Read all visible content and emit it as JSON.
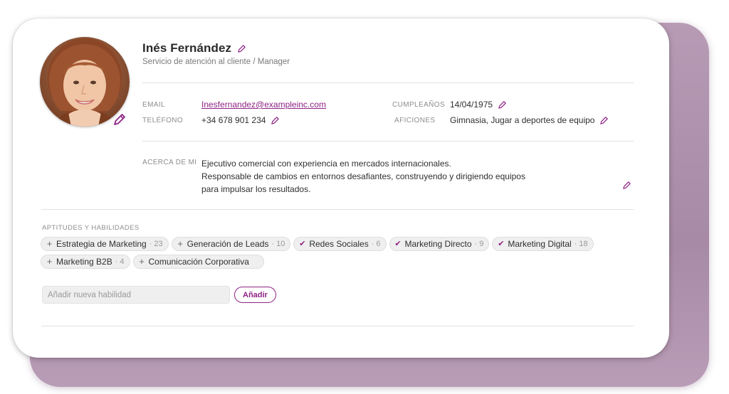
{
  "profile": {
    "name": "Inés Fernández",
    "department": "Servicio de atención al cliente /",
    "role": "Manager",
    "avatar_alt": "Foto de perfil"
  },
  "contact": {
    "email_label": "EMAIL",
    "email": "Inesfernandez@exampleinc.com",
    "phone_label": "TELÉFONO",
    "phone": "+34 678 901 234",
    "birthday_label": "CUMPLEAÑOS",
    "birthday": "14/04/1975",
    "hobbies_label": "AFICIONES",
    "hobbies": "Gimnasia, Jugar a deportes de equipo"
  },
  "about": {
    "label": "ACERCA DE MI",
    "lines": [
      "Ejecutivo comercial con experiencia en mercados internacionales.",
      "Responsable de cambios en entornos desafiantes, construyendo y dirigiendo equipos",
      "para impulsar los resultados."
    ]
  },
  "skills": {
    "title": "APTITUDES Y HABILIDADES",
    "items": [
      {
        "label": "Estrategia de Marketing",
        "count": "23",
        "endorsed": false
      },
      {
        "label": "Generación de Leads",
        "count": "10",
        "endorsed": false
      },
      {
        "label": "Redes Sociales",
        "count": "6",
        "endorsed": true
      },
      {
        "label": "Marketing Directo",
        "count": "9",
        "endorsed": true
      },
      {
        "label": "Marketing Digital",
        "count": "18",
        "endorsed": true
      },
      {
        "label": "Marketing B2B",
        "count": "4",
        "endorsed": false
      },
      {
        "label": "Comunicación Corporativa",
        "count": "",
        "endorsed": false
      }
    ],
    "add_placeholder": "Añadir nueva habilidad",
    "add_button": "Añadir"
  },
  "colors": {
    "accent": "#8e2384",
    "shadow_card": "#b79bb5"
  },
  "icons": {
    "edit": "pencil-icon",
    "endorsed": "check-icon",
    "not_endorsed": "plus-icon"
  }
}
